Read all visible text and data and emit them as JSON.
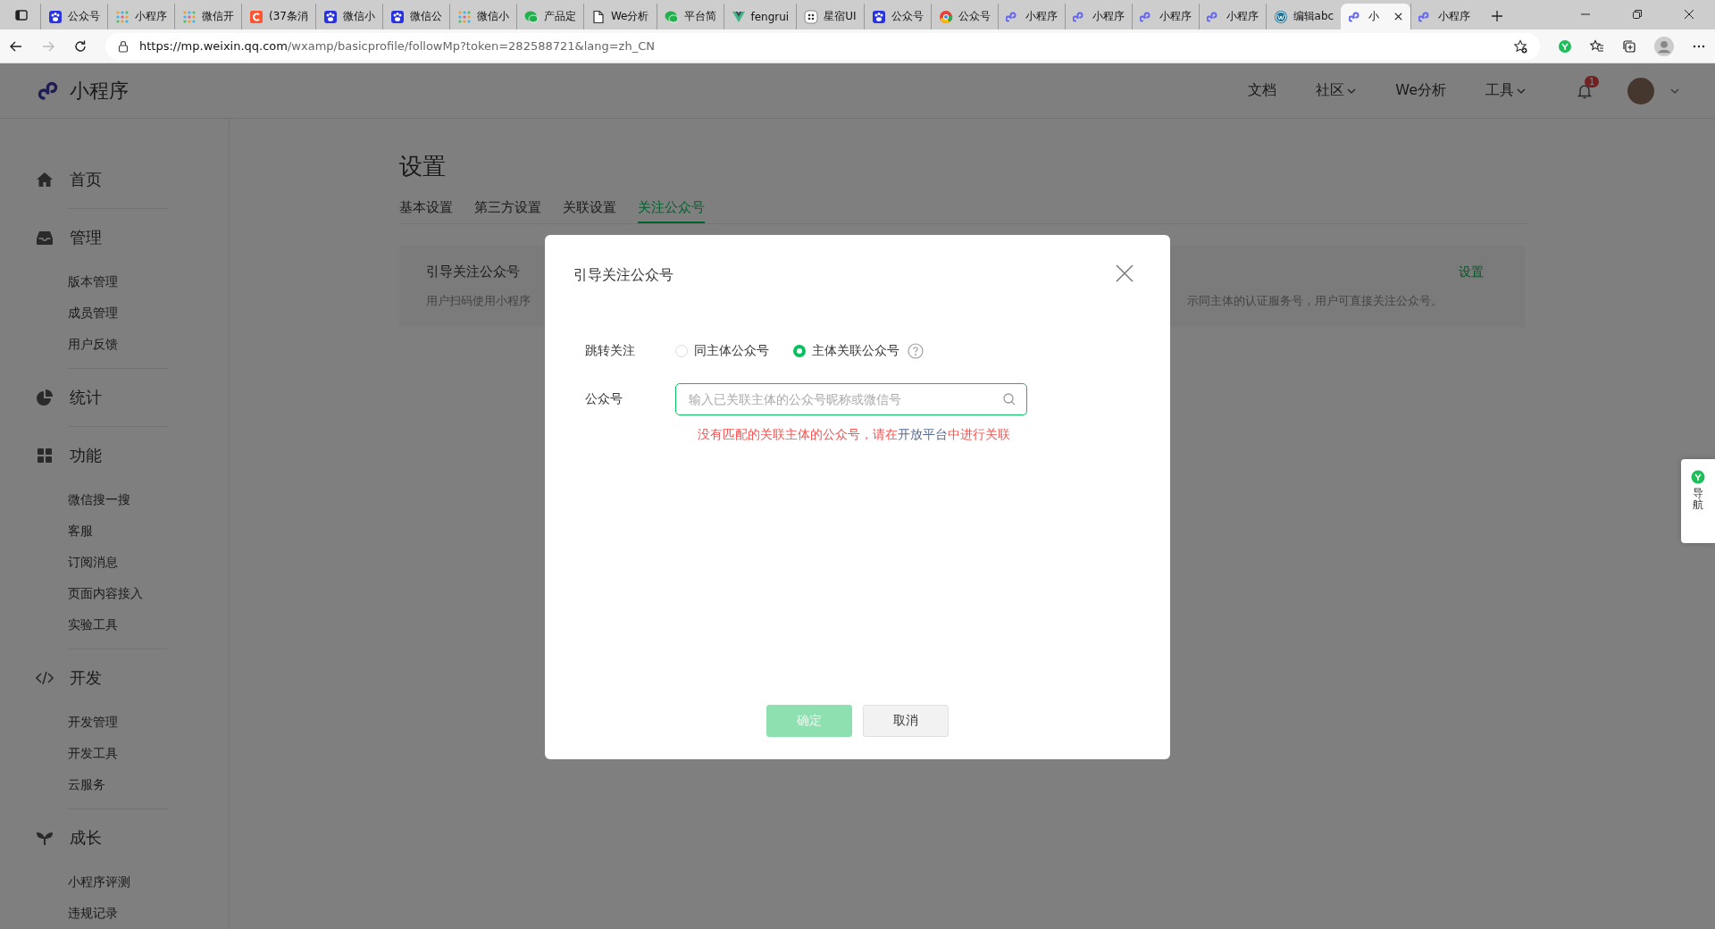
{
  "browser": {
    "tabs": [
      {
        "title": "公众号",
        "kind": "baidu",
        "selected": false
      },
      {
        "title": "小程序",
        "kind": "grid",
        "selected": false
      },
      {
        "title": "微信开",
        "kind": "grid",
        "selected": false
      },
      {
        "title": "(37条消",
        "kind": "csdn",
        "selected": false
      },
      {
        "title": "微信小",
        "kind": "baidu",
        "selected": false
      },
      {
        "title": "微信公",
        "kind": "baidu",
        "selected": false
      },
      {
        "title": "微信小",
        "kind": "grid",
        "selected": false
      },
      {
        "title": "产品定",
        "kind": "wechat",
        "selected": false
      },
      {
        "title": "We分析",
        "kind": "doc",
        "selected": false
      },
      {
        "title": "平台简",
        "kind": "wechat",
        "selected": false
      },
      {
        "title": "fengrui",
        "kind": "vue",
        "selected": false
      },
      {
        "title": "星宿UI",
        "kind": "dots",
        "selected": false
      },
      {
        "title": "公众号",
        "kind": "baidu",
        "selected": false
      },
      {
        "title": "公众号",
        "kind": "chrome",
        "selected": false
      },
      {
        "title": "小程序",
        "kind": "miniprogram",
        "selected": false
      },
      {
        "title": "小程序",
        "kind": "miniprogram",
        "selected": false
      },
      {
        "title": "小程序",
        "kind": "miniprogram",
        "selected": false
      },
      {
        "title": "小程序",
        "kind": "miniprogram",
        "selected": false
      },
      {
        "title": "编辑abc",
        "kind": "wordpress",
        "selected": false
      },
      {
        "title": "小",
        "kind": "miniprogram",
        "selected": true
      },
      {
        "title": "小程序",
        "kind": "miniprogram",
        "selected": false
      }
    ],
    "url": {
      "host": "https://mp.weixin.qq.com",
      "path": "/wxamp/basicprofile/followMp?token=282588721&lang=zh_CN"
    }
  },
  "header": {
    "logo_text": "小程序",
    "nav": [
      {
        "label": "文档",
        "dropdown": false
      },
      {
        "label": "社区",
        "dropdown": true
      },
      {
        "label": "We分析",
        "dropdown": false
      },
      {
        "label": "工具",
        "dropdown": true
      }
    ],
    "notification_count": "1"
  },
  "sidebar": {
    "sections": [
      {
        "label": "首页",
        "kind": "home"
      },
      {
        "label": "管理",
        "kind": "inbox",
        "items": [
          "版本管理",
          "成员管理",
          "用户反馈"
        ]
      },
      {
        "label": "统计",
        "kind": "pie"
      },
      {
        "label": "功能",
        "kind": "grid",
        "items": [
          "微信搜一搜",
          "客服",
          "订阅消息",
          "页面内容接入",
          "实验工具"
        ]
      },
      {
        "label": "开发",
        "kind": "code",
        "items": [
          "开发管理",
          "开发工具",
          "云服务"
        ]
      },
      {
        "label": "成长",
        "kind": "sprout",
        "items": [
          "小程序评测",
          "违规记录"
        ]
      }
    ]
  },
  "page": {
    "title": "设置",
    "tabs": [
      {
        "label": "基本设置",
        "selected": false
      },
      {
        "label": "第三方设置",
        "selected": false
      },
      {
        "label": "关联设置",
        "selected": false
      },
      {
        "label": "关注公众号",
        "selected": true
      }
    ],
    "card": {
      "title": "引导关注公众号",
      "action": "设置",
      "description_left": "用户扫码使用小程序",
      "description_right": "示同主体的认证服务号，用户可直接关注公众号。"
    }
  },
  "modal": {
    "title": "引导关注公众号",
    "jump_label": "跳转关注",
    "options": [
      {
        "label": "同主体公众号",
        "selected": false
      },
      {
        "label": "主体关联公众号",
        "selected": true
      }
    ],
    "account_label": "公众号",
    "placeholder": "输入已关联主体的公众号昵称或微信号",
    "error": {
      "before": "没有匹配的关联主体的公众号，请在",
      "link": "开放平台",
      "after": "中进行关联"
    },
    "buttons": [
      {
        "label": "确定",
        "kind": "primary",
        "disabled": true
      },
      {
        "label": "取消",
        "kind": "default",
        "disabled": false
      }
    ]
  },
  "side_nav": {
    "label": "导航"
  }
}
